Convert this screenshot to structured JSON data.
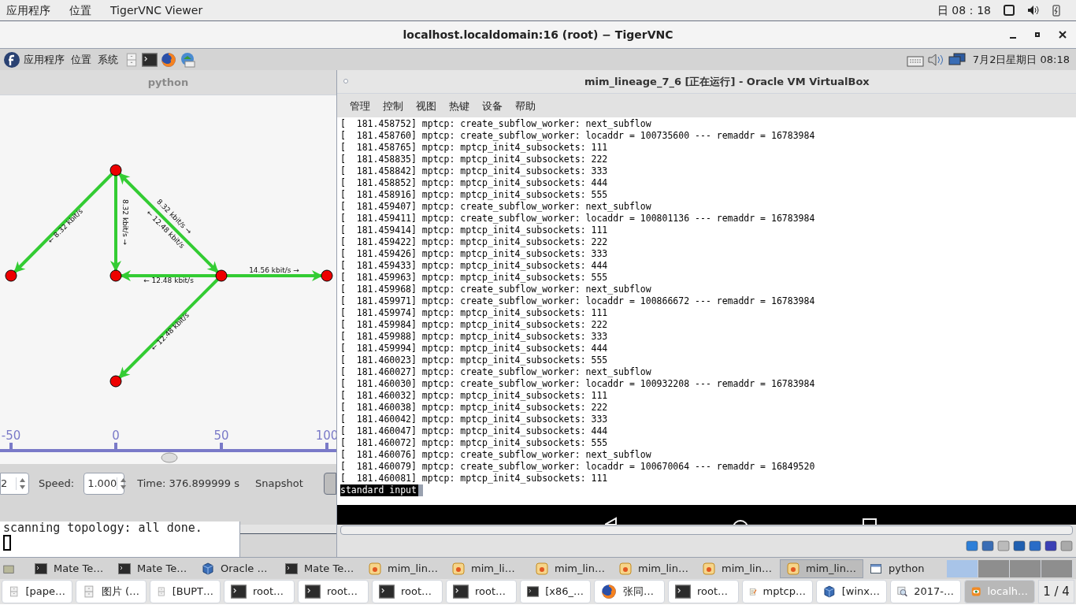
{
  "top_bar": {
    "menus": [
      "应用程序",
      "位置",
      "TigerVNC Viewer"
    ],
    "clock": "日 08：18"
  },
  "vnc_window": {
    "title": "localhost.localdomain:16 (root) − TigerVNC"
  },
  "inner_panel": {
    "menus": [
      "应用程序",
      "位置",
      "系统"
    ],
    "clock": "7月2日星期日 08:18"
  },
  "python_window": {
    "title": "python",
    "graph": {
      "edges": [
        {
          "labels": [
            "← 8.32 kbit/s"
          ]
        },
        {
          "labels": [
            "8.32 kbit/s →"
          ]
        },
        {
          "labels": [
            "8.32 kbit/s →",
            "← 12.48 kbit/s"
          ]
        },
        {
          "labels": [
            "← 12.48 kbit/s"
          ]
        },
        {
          "labels": [
            "14.56 kbit/s →"
          ]
        },
        {
          "labels": [
            "← 12.48 kbit/s"
          ]
        }
      ],
      "axis_ticks": [
        "-50",
        "0",
        "50",
        "100"
      ]
    },
    "controls": {
      "step_value": "2",
      "speed_label": "Speed:",
      "speed_value": "1.000",
      "time": "Time: 376.899999 s",
      "snapshot": "Snapshot"
    }
  },
  "python_console": {
    "text": "scanning topology: all done."
  },
  "vbox_window": {
    "title": "mim_lineage_7_6 [正在运行] - Oracle VM VirtualBox",
    "menus": [
      "管理",
      "控制",
      "视图",
      "热键",
      "设备",
      "帮助"
    ],
    "console_lines": [
      "[  181.458752] mptcp: create_subflow_worker: next_subflow",
      "[  181.458760] mptcp: create_subflow_worker: locaddr = 100735600 --- remaddr = 16783984",
      "[  181.458765] mptcp: mptcp_init4_subsockets: 111",
      "[  181.458835] mptcp: mptcp_init4_subsockets: 222",
      "[  181.458842] mptcp: mptcp_init4_subsockets: 333",
      "[  181.458852] mptcp: mptcp_init4_subsockets: 444",
      "[  181.458916] mptcp: mptcp_init4_subsockets: 555",
      "[  181.459407] mptcp: create_subflow_worker: next_subflow",
      "[  181.459411] mptcp: create_subflow_worker: locaddr = 100801136 --- remaddr = 16783984",
      "[  181.459414] mptcp: mptcp_init4_subsockets: 111",
      "[  181.459422] mptcp: mptcp_init4_subsockets: 222",
      "[  181.459426] mptcp: mptcp_init4_subsockets: 333",
      "[  181.459433] mptcp: mptcp_init4_subsockets: 444",
      "[  181.459963] mptcp: mptcp_init4_subsockets: 555",
      "[  181.459968] mptcp: create_subflow_worker: next_subflow",
      "[  181.459971] mptcp: create_subflow_worker: locaddr = 100866672 --- remaddr = 16783984",
      "[  181.459974] mptcp: mptcp_init4_subsockets: 111",
      "[  181.459984] mptcp: mptcp_init4_subsockets: 222",
      "[  181.459988] mptcp: mptcp_init4_subsockets: 333",
      "[  181.459994] mptcp: mptcp_init4_subsockets: 444",
      "[  181.460023] mptcp: mptcp_init4_subsockets: 555",
      "[  181.460027] mptcp: create_subflow_worker: next_subflow",
      "[  181.460030] mptcp: create_subflow_worker: locaddr = 100932208 --- remaddr = 16783984",
      "[  181.460032] mptcp: mptcp_init4_subsockets: 111",
      "[  181.460038] mptcp: mptcp_init4_subsockets: 222",
      "[  181.460042] mptcp: mptcp_init4_subsockets: 333",
      "[  181.460047] mptcp: mptcp_init4_subsockets: 444",
      "[  181.460072] mptcp: mptcp_init4_subsockets: 555",
      "[  181.460076] mptcp: create_subflow_worker: next_subflow",
      "[  181.460079] mptcp: create_subflow_worker: locaddr = 100670064 --- remaddr = 16849520",
      "[  181.460081] mptcp: mptcp_init4_subsockets: 111"
    ],
    "status_line": "standard input"
  },
  "window_list": [
    {
      "kind": "terminal",
      "label": "Mate Te…",
      "selected": false
    },
    {
      "kind": "terminal",
      "label": "Mate Te…",
      "selected": false
    },
    {
      "kind": "vbox",
      "label": "Oracle …",
      "selected": false
    },
    {
      "kind": "terminal",
      "label": "Mate Te…",
      "selected": false
    },
    {
      "kind": "vm",
      "label": "mim_lin…",
      "selected": false
    },
    {
      "kind": "vm",
      "label": "mim_li…",
      "selected": false
    },
    {
      "kind": "vm",
      "label": "mim_lin…",
      "selected": false
    },
    {
      "kind": "vm",
      "label": "mim_lin…",
      "selected": false
    },
    {
      "kind": "vm",
      "label": "mim_lin…",
      "selected": false
    },
    {
      "kind": "vm",
      "label": "mim_lin…",
      "selected": true
    },
    {
      "kind": "window",
      "label": "python",
      "selected": false
    }
  ],
  "workspaces": [
    {
      "selected": true
    },
    {
      "selected": false
    },
    {
      "selected": false
    },
    {
      "selected": false
    }
  ],
  "host_taskbar": [
    {
      "kind": "file",
      "label": "[pape…",
      "selected": false
    },
    {
      "kind": "file",
      "label": "图片 (…",
      "selected": false
    },
    {
      "kind": "file",
      "label": "[BUPT…",
      "selected": false
    },
    {
      "kind": "terminal",
      "label": "root…",
      "selected": false
    },
    {
      "kind": "terminal",
      "label": "root…",
      "selected": false
    },
    {
      "kind": "terminal",
      "label": "root…",
      "selected": false
    },
    {
      "kind": "terminal",
      "label": "root…",
      "selected": false
    },
    {
      "kind": "terminal",
      "label": "[x86_…",
      "selected": false
    },
    {
      "kind": "firefox",
      "label": "张同…",
      "selected": false
    },
    {
      "kind": "terminal",
      "label": "root…",
      "selected": false
    },
    {
      "kind": "editor",
      "label": "mptcp…",
      "selected": false
    },
    {
      "kind": "vbox",
      "label": "[winx…",
      "selected": false
    },
    {
      "kind": "viewer",
      "label": "2017-…",
      "selected": false
    },
    {
      "kind": "vnc",
      "label": "localh…",
      "selected": true
    }
  ],
  "workspace_indicator": "1 / 4"
}
